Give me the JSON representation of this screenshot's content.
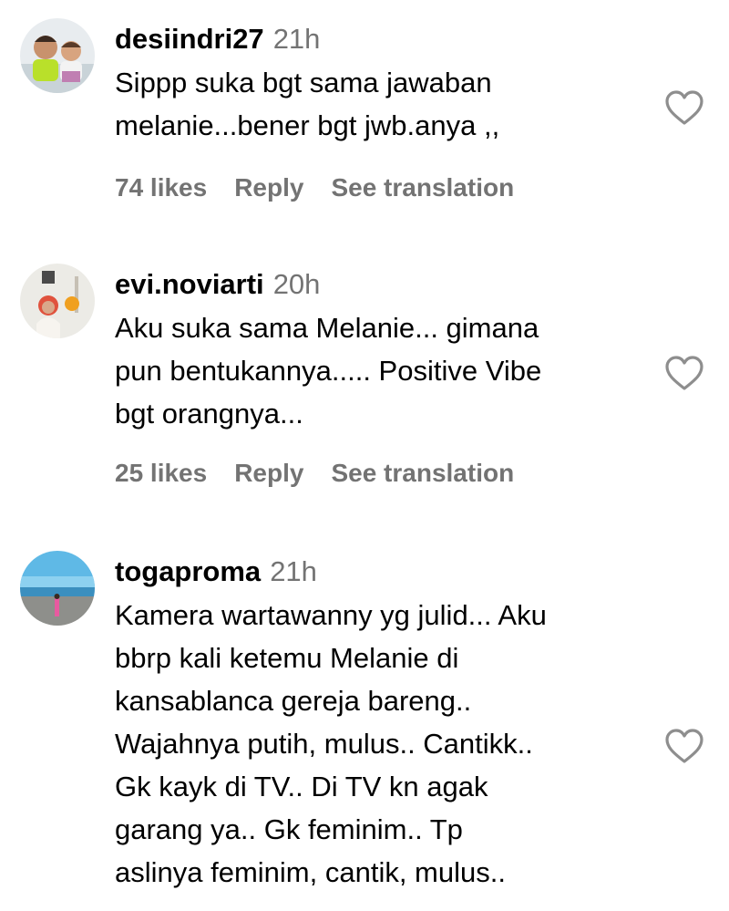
{
  "comments": [
    {
      "username": "desiindri27",
      "time": "21h",
      "lines": [
        "Sippp suka bgt sama jawaban",
        "melanie...bener bgt jwb.anya ,,"
      ],
      "likes": "74 likes",
      "reply": "Reply",
      "translate": "See translation",
      "avatar_icon": "avatar-photo-two-children"
    },
    {
      "username": "evi.noviarti",
      "time": "20h",
      "lines": [
        "Aku suka sama Melanie... gimana",
        "pun bentukannya..... Positive Vibe",
        "bgt orangnya..."
      ],
      "likes": "25 likes",
      "reply": "Reply",
      "translate": "See translation",
      "avatar_icon": "avatar-photo-woman-with-balloon"
    },
    {
      "username": "togaproma",
      "time": "21h",
      "lines": [
        "Kamera wartawanny yg julid... Aku",
        "bbrp kali ketemu Melanie di",
        "kansablanca gereja bareng..",
        "Wajahnya putih, mulus.. Cantikk..",
        "Gk kayk di TV.. Di TV kn agak",
        "garang ya.. Gk feminim.. Tp",
        "aslinya feminim, cantik, mulus.."
      ],
      "avatar_icon": "avatar-photo-beach-scene"
    }
  ],
  "colors": {
    "text": "#000000",
    "secondary": "#737373",
    "heart_stroke": "#8e8e8e"
  },
  "icons": {
    "like": "heart-outline-icon"
  }
}
